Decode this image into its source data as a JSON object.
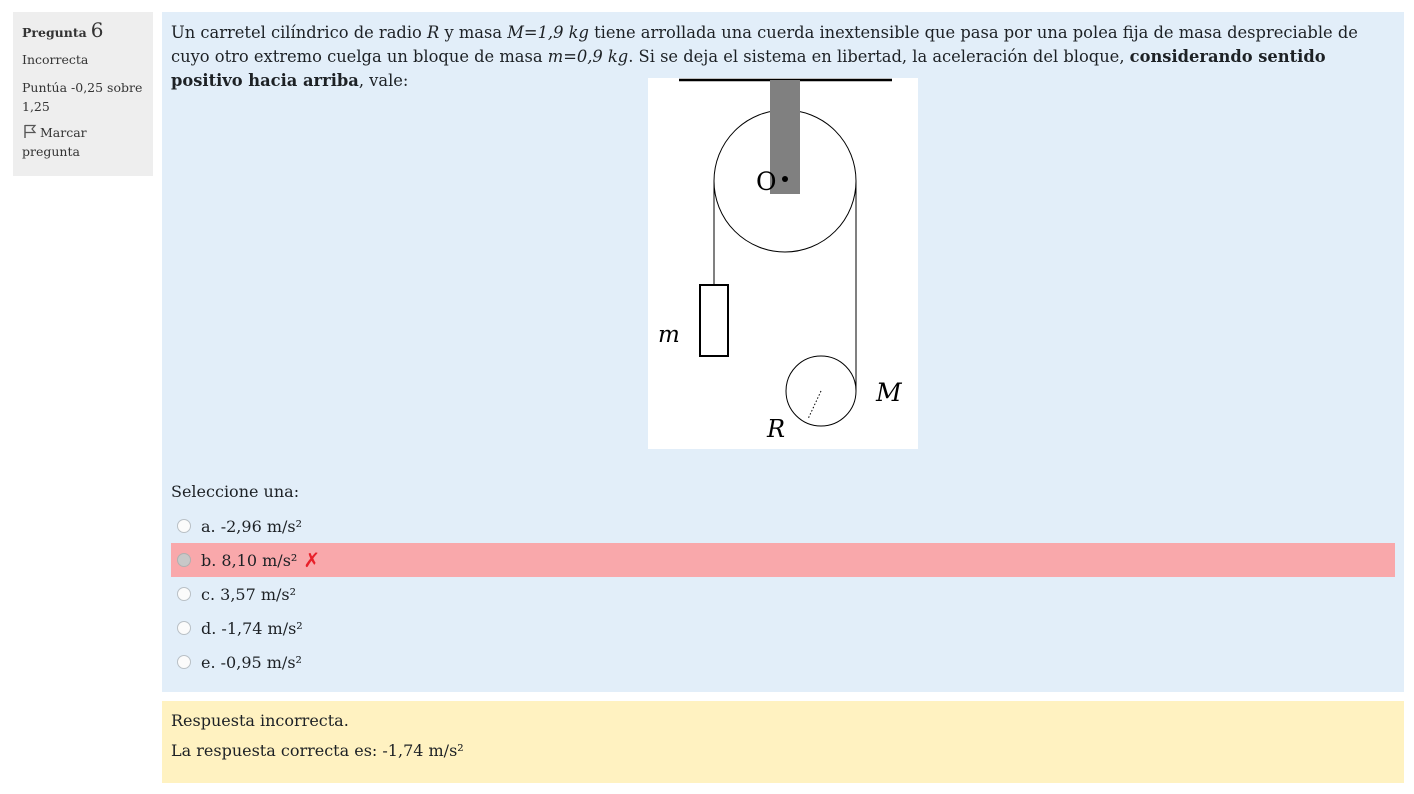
{
  "info": {
    "question_label": "Pregunta",
    "question_number": "6",
    "state": "Incorrecta",
    "grade": "Puntúa -0,25 sobre 1,25",
    "flag_label": "Marcar pregunta"
  },
  "question": {
    "t1": "Un carretel cilíndrico de radio ",
    "var_R": "R",
    "t2": " y masa ",
    "var_M": "M=1,9 kg",
    "t3": " tiene arrollada una cuerda inextensible que pasa por una polea fija de masa despreciable de cuyo otro extremo cuelga un bloque de masa ",
    "var_m": "m=0,9 kg",
    "t4": ". Si se deja el sistema en libertad, la aceleración del bloque, ",
    "bold": "considerando sentido positivo hacia arriba",
    "t5": ", vale:"
  },
  "figure": {
    "label_O": "O",
    "label_m": "m",
    "label_M": "M",
    "label_R": "R"
  },
  "prompt": "Seleccione una:",
  "options": [
    {
      "label": "a. -2,96 m/s²"
    },
    {
      "label": "b. 8,10 m/s²"
    },
    {
      "label": "c. 3,57 m/s²"
    },
    {
      "label": "d. -1,74 m/s²"
    },
    {
      "label": "e. -0,95 m/s²"
    }
  ],
  "selected_index": 1,
  "icons": {
    "incorrect": "cross-icon",
    "flag": "flag-icon"
  },
  "colors": {
    "incorrect_bg": "#f9a8ab",
    "feedback_bg": "#fff2c1",
    "content_bg": "#e2eef9",
    "cross": "#e8202a"
  },
  "feedback": {
    "general": "Respuesta incorrecta.",
    "right_answer": "La respuesta correcta es: -1,74 m/s²"
  }
}
